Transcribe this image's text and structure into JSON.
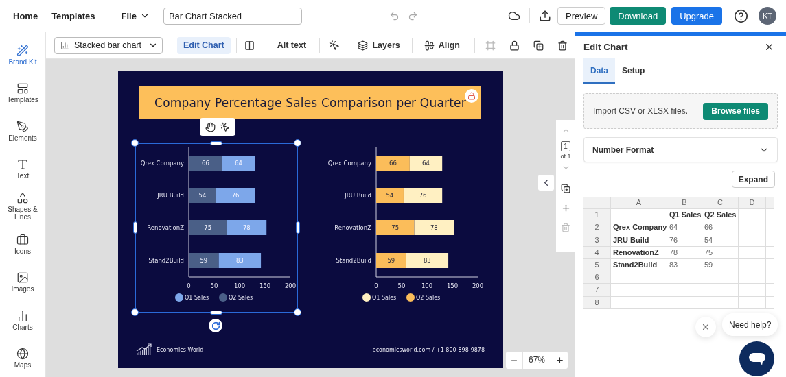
{
  "top_bar": {
    "nav": [
      "Home",
      "Templates"
    ],
    "file_menu": "File",
    "document_title": "Bar Chart Stacked",
    "preview": "Preview",
    "download": "Download",
    "upgrade": "Upgrade",
    "avatar": "KT"
  },
  "sidebar": {
    "items": [
      {
        "label": "Brand Kit",
        "selected": true
      },
      {
        "label": "Templates",
        "selected": false
      },
      {
        "label": "Elements",
        "selected": false
      },
      {
        "label": "Text",
        "selected": false
      },
      {
        "label": "Shapes & Lines",
        "selected": false
      },
      {
        "label": "Icons",
        "selected": false
      },
      {
        "label": "Images",
        "selected": false
      },
      {
        "label": "Charts",
        "selected": false
      },
      {
        "label": "Maps",
        "selected": false
      }
    ]
  },
  "toolbar": {
    "chart_type": "Stacked bar chart",
    "edit_chart": {
      "label": "Edit Chart",
      "selected": true
    },
    "alt_text": "Alt text",
    "layers": "Layers",
    "align": "Align"
  },
  "design": {
    "title": "Company Percentage Sales Comparison per Quarter",
    "charts": [
      {
        "selected": true,
        "chart_data": {
          "type": "bar",
          "orientation": "horizontal",
          "stacked": true,
          "categories": [
            "Qrex Company",
            "JRU Build",
            "RenovationZ",
            "Stand2Build"
          ],
          "series": [
            {
              "name": "Q1 Sales",
              "color": "#7da7ea",
              "values": [
                64,
                76,
                78,
                83
              ]
            },
            {
              "name": "Q2 Sales",
              "color": "#4a5f87",
              "values": [
                66,
                54,
                75,
                59
              ]
            }
          ],
          "xlim": [
            0,
            200
          ],
          "xticks": [
            0,
            50,
            100,
            150,
            200
          ],
          "data_labels": true,
          "legend": "bottom"
        }
      },
      {
        "selected": false,
        "chart_data": {
          "type": "bar",
          "orientation": "horizontal",
          "stacked": true,
          "categories": [
            "Qrex Company",
            "JRU Build",
            "RenovationZ",
            "Stand2Build"
          ],
          "series": [
            {
              "name": "Q1 Sales",
              "color": "#fff0c2",
              "values": [
                64,
                76,
                78,
                83
              ]
            },
            {
              "name": "Q2 Sales",
              "color": "#fbbd5a",
              "values": [
                66,
                54,
                75,
                59
              ]
            }
          ],
          "xlim": [
            0,
            200
          ],
          "xticks": [
            0,
            50,
            100,
            150,
            200
          ],
          "data_labels": true,
          "legend": "bottom"
        }
      }
    ],
    "brand": "Economics World",
    "contact": "economicsworld.com / +1 800-898-9878"
  },
  "page_nav": {
    "page": "1",
    "of": "of 1"
  },
  "zoom": {
    "value": "67%"
  },
  "panel": {
    "title": "Edit Chart",
    "tabs": [
      {
        "label": "Data",
        "selected": true
      },
      {
        "label": "Setup",
        "selected": false
      }
    ],
    "import_text": "Import CSV or XLSX files.",
    "browse": "Browse files",
    "number_format": "Number Format",
    "expand": "Expand",
    "sheet": {
      "columns": [
        "A",
        "B",
        "C",
        "D"
      ],
      "rows": [
        {
          "number": "1",
          "cells": [
            null,
            "Q1 Sales",
            "Q2 Sales"
          ]
        },
        {
          "number": "2",
          "cells": [
            "Qrex Company",
            "64",
            "66"
          ]
        },
        {
          "number": "3",
          "cells": [
            "JRU Build",
            "76",
            "54"
          ]
        },
        {
          "number": "4",
          "cells": [
            "RenovationZ",
            "78",
            "75"
          ]
        },
        {
          "number": "5",
          "cells": [
            "Stand2Build",
            "83",
            "59"
          ]
        },
        {
          "number": "6"
        },
        {
          "number": "7"
        },
        {
          "number": "8"
        }
      ]
    }
  },
  "help": {
    "label": "Need help?"
  }
}
